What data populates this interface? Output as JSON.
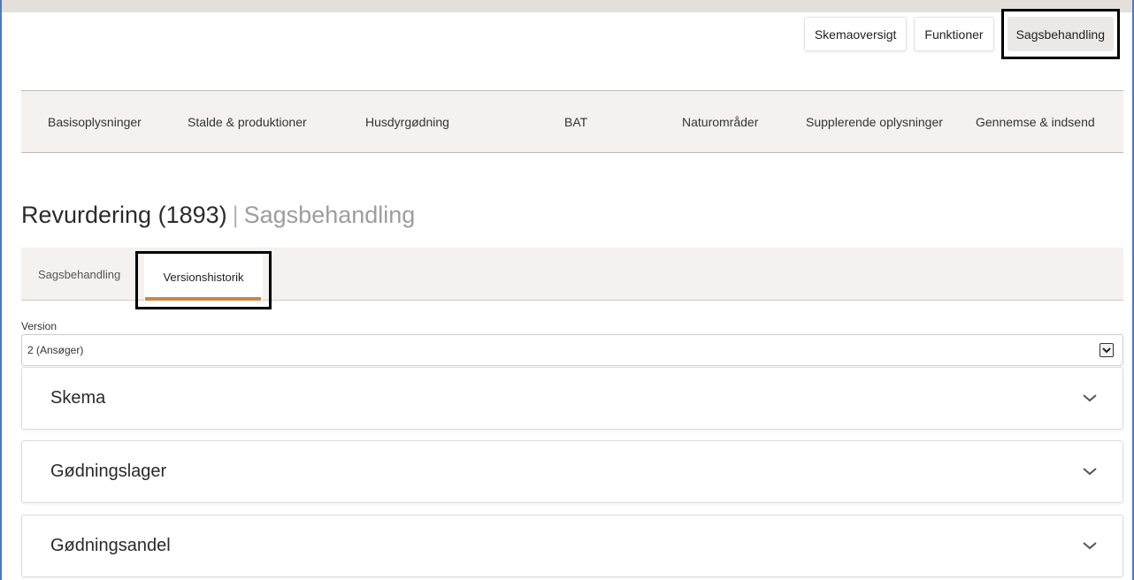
{
  "header_buttons": {
    "skemaoversigt": "Skemaoversigt",
    "funktioner": "Funktioner",
    "sagsbehandling": "Sagsbehandling"
  },
  "nav": {
    "items": [
      {
        "label": "Basisoplysninger"
      },
      {
        "label": "Stalde & produktioner"
      },
      {
        "label": "Husdyrgødning"
      },
      {
        "label": "BAT"
      },
      {
        "label": "Naturområder"
      },
      {
        "label": "Supplerende oplysninger"
      },
      {
        "label": "Gennemse & indsend"
      }
    ]
  },
  "page": {
    "title": "Revurdering (1893)",
    "separator": "|",
    "subtitle": "Sagsbehandling"
  },
  "tabs": {
    "sagsbehandling": "Sagsbehandling",
    "versionshistorik": "Versionshistorik"
  },
  "version": {
    "label": "Version",
    "selected": "2 (Ansøger)"
  },
  "panels": [
    {
      "title": "Skema"
    },
    {
      "title": "Gødningslager"
    },
    {
      "title": "Gødningsandel"
    }
  ],
  "colors": {
    "accent_underline": "#c98a3e",
    "nav_background": "#f4f1ee",
    "frame_border": "#4a7bbf"
  }
}
